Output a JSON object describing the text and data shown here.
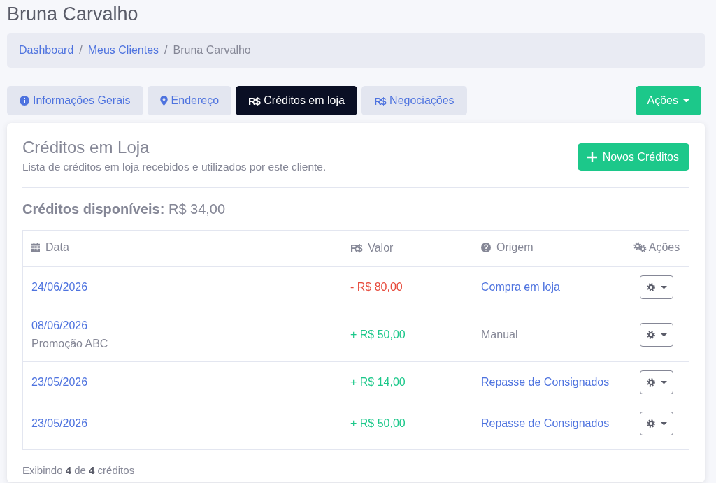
{
  "page_title": "Bruna Carvalho",
  "breadcrumb": [
    {
      "label": "Dashboard",
      "current": false
    },
    {
      "separator": "/",
      "label": "Meus Clientes",
      "current": false
    },
    {
      "separator": "/",
      "label": "Bruna Carvalho",
      "current": true
    }
  ],
  "tabs": [
    {
      "label": "Informações Gerais",
      "selected": false
    },
    {
      "label": "Endereço",
      "selected": false
    },
    {
      "symbol": "R$",
      "label": "Créditos em loja",
      "selected": true
    },
    {
      "symbol": "R$",
      "label": "Negociações",
      "selected": false
    }
  ],
  "actions_button": {
    "label": "Ações"
  },
  "credits_card": {
    "title": "Créditos em Loja",
    "subtitle": "Lista de créditos em loja recebidos e utilizados por este cliente.",
    "new_button": {
      "label": "Novos Créditos"
    },
    "available": "**Créditos disponíveis:** R$ 34,00",
    "table": {
      "columns": [
        {
          "label": "Data"
        },
        {
          "symbol": "R$",
          "label": "Valor"
        },
        {
          "label": "Origem"
        },
        {
          "label": "Ações"
        }
      ],
      "rows": [
        {
          "date": "24/06/2026",
          "value": "- R$ 80,00",
          "negative": true,
          "origin": {
            "text": "Compra em loja",
            "link": true
          }
        },
        {
          "date": "08/06/2026",
          "note": "Promoção ABC",
          "value": "+ R$ 50,00",
          "negative": false,
          "origin": {
            "text": "Manual",
            "link": false
          }
        },
        {
          "date": "23/05/2026",
          "value": "+ R$ 14,00",
          "negative": false,
          "origin": {
            "text": "Repasse de Consignados",
            "link": true
          }
        },
        {
          "date": "23/05/2026",
          "value": "+ R$ 50,00",
          "negative": false,
          "origin": {
            "text": "Repasse de Consignados",
            "link": true
          }
        }
      ]
    },
    "summary": "Exibindo **4** de **4** créditos"
  }
}
